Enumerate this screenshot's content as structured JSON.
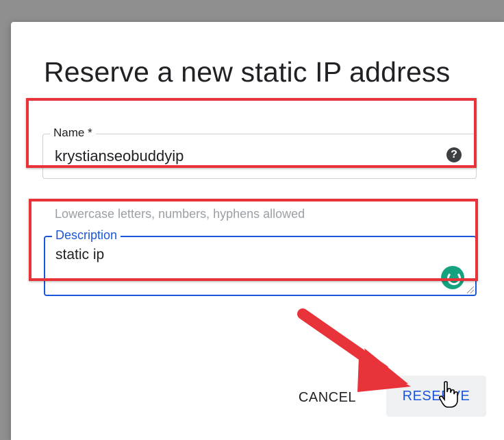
{
  "dialog": {
    "title": "Reserve a new static IP address"
  },
  "name_field": {
    "label": "Name *",
    "value": "krystianseobuddyip",
    "hint": "Lowercase letters, numbers, hyphens allowed",
    "help_icon": "help-circle-icon"
  },
  "description_field": {
    "label": "Description",
    "value": "static ip",
    "assist_icon": "grammarly-icon"
  },
  "actions": {
    "cancel_label": "CANCEL",
    "reserve_label": "RESERVE"
  },
  "annotations": {
    "highlight_color": "#e8333a",
    "arrow_color": "#e8333a"
  },
  "colors": {
    "accent": "#1a56db",
    "grammarly": "#15a37f"
  }
}
